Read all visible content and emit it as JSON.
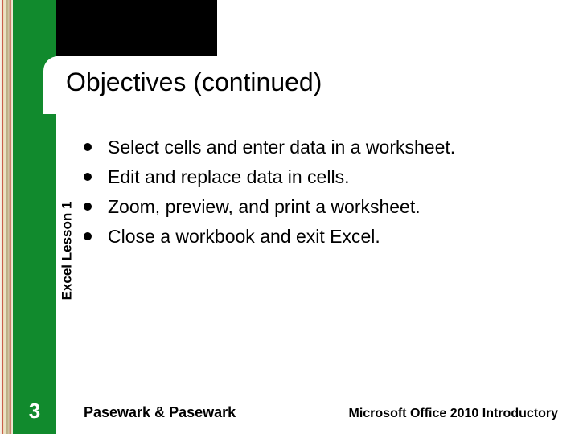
{
  "title": "Objectives (continued)",
  "sidebar_label": "Excel Lesson 1",
  "page_number": "3",
  "bullets": [
    "Select cells and enter data in a worksheet.",
    "Edit and replace data in cells.",
    "Zoom, preview, and print a worksheet.",
    "Close a workbook and exit Excel."
  ],
  "footer": {
    "left": "Pasewark & Pasewark",
    "right": "Microsoft Office 2010 Introductory"
  }
}
